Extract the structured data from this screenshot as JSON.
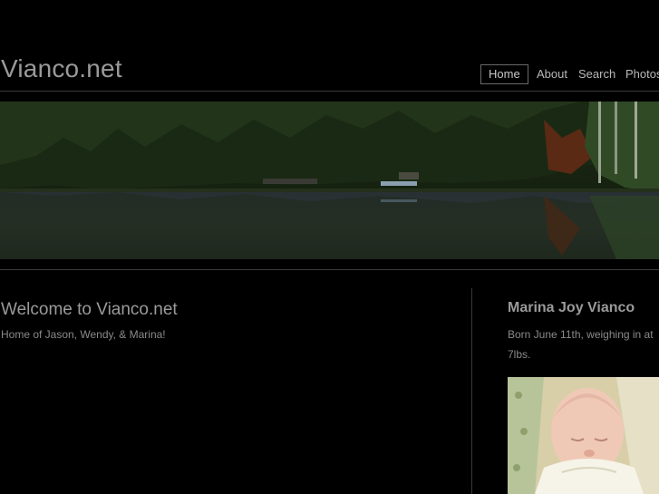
{
  "site": {
    "title": "Vianco.net"
  },
  "nav": {
    "items": [
      "Home",
      "About",
      "Search",
      "Photos"
    ],
    "active": "Home"
  },
  "main": {
    "heading": "Welcome to Vianco.net",
    "subtitle": "Home of Jason, Wendy, & Marina!"
  },
  "sidebar": {
    "heading": "Marina Joy Vianco",
    "text": "Born June 11th, weighing in at 7lbs."
  },
  "colors": {
    "background": "#000000",
    "text": "#8a8a8a",
    "rule": "#3a3a3a"
  }
}
